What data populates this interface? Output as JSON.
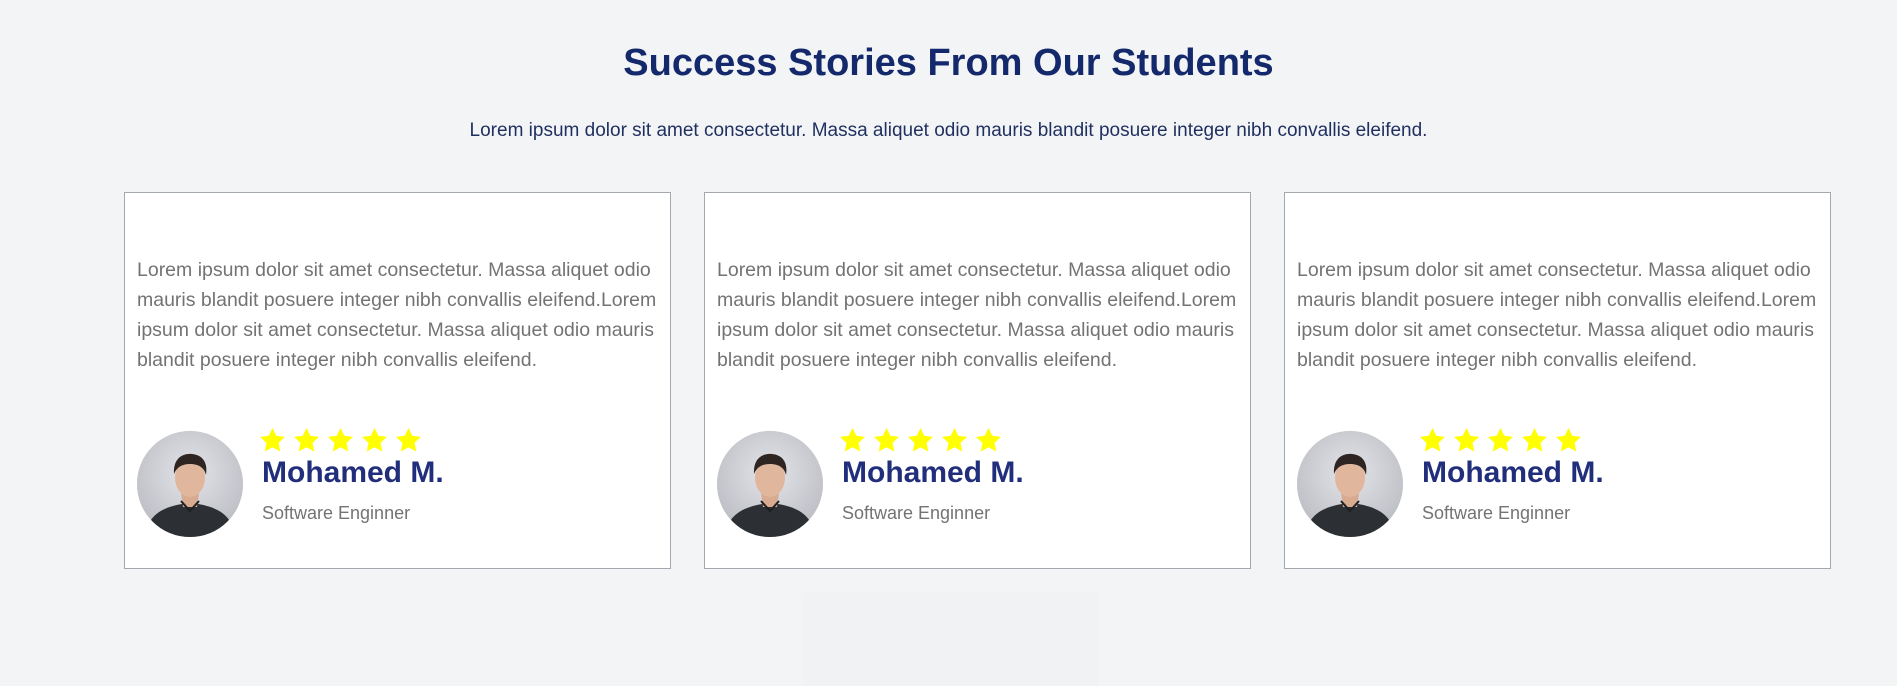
{
  "section": {
    "title": "Success Stories From Our Students",
    "subtitle": "Lorem ipsum dolor sit amet consectetur. Massa aliquet odio mauris blandit posuere integer nibh convallis eleifend."
  },
  "colors": {
    "background": "#f3f4f6",
    "title": "#14296b",
    "name": "#212e7c",
    "star": "#ffff00",
    "card_border": "#a3a8ae",
    "body_text": "#737373"
  },
  "testimonials": [
    {
      "quote": "Lorem ipsum dolor sit amet consectetur. Massa aliquet odio mauris blandit posuere integer nibh convallis eleifend.Lorem ipsum dolor sit amet consectetur. Massa aliquet odio mauris blandit posuere integer nibh convallis eleifend.",
      "rating": 5,
      "name": "Mohamed M.",
      "role": "Software Enginner",
      "avatar_icon": "person-avatar"
    },
    {
      "quote": "Lorem ipsum dolor sit amet consectetur. Massa aliquet odio mauris blandit posuere integer nibh convallis eleifend.Lorem ipsum dolor sit amet consectetur. Massa aliquet odio mauris blandit posuere integer nibh convallis eleifend.",
      "rating": 5,
      "name": "Mohamed M.",
      "role": "Software Enginner",
      "avatar_icon": "person-avatar"
    },
    {
      "quote": "Lorem ipsum dolor sit amet consectetur. Massa aliquet odio mauris blandit posuere integer nibh convallis eleifend.Lorem ipsum dolor sit amet consectetur. Massa aliquet odio mauris blandit posuere integer nibh convallis eleifend.",
      "rating": 5,
      "name": "Mohamed M.",
      "role": "Software Enginner",
      "avatar_icon": "person-avatar"
    }
  ]
}
